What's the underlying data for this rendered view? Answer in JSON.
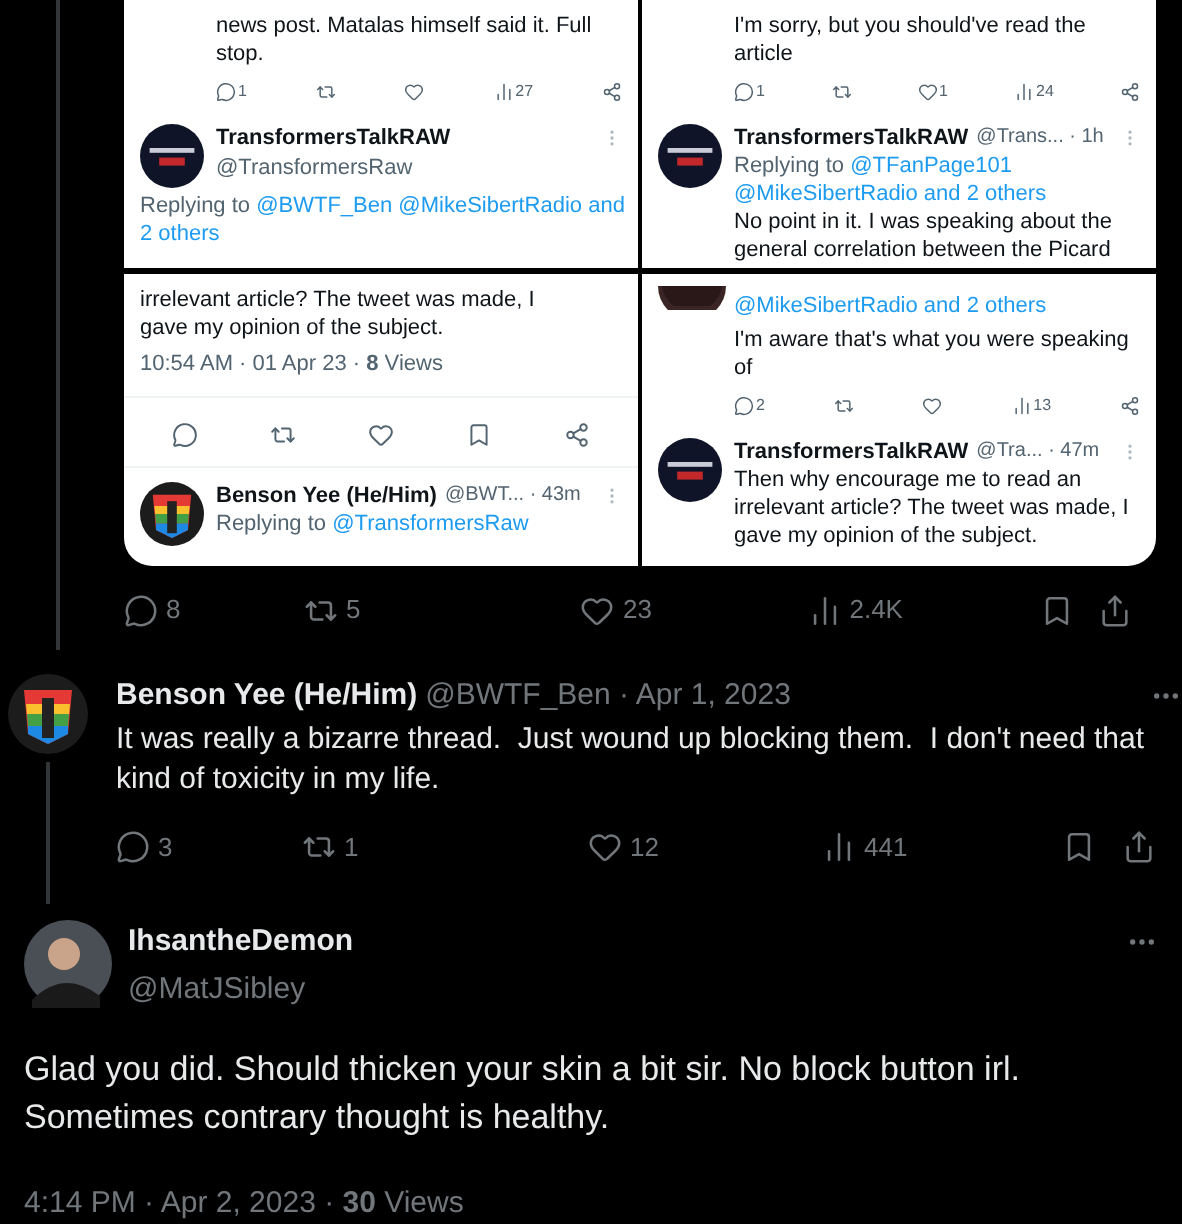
{
  "attached_image": {
    "columns": [
      {
        "panels": [
          {
            "kind": "thread",
            "blocks": [
              {
                "kind": "text",
                "lines": [
                  "news post.  Matalas himself said it.  Full",
                  "stop."
                ]
              },
              {
                "kind": "stats",
                "items": [
                  {
                    "kind": "reply",
                    "count": "1"
                  },
                  {
                    "kind": "repost"
                  },
                  {
                    "kind": "like"
                  },
                  {
                    "kind": "views",
                    "count": "27"
                  },
                  {
                    "kind": "share"
                  }
                ]
              },
              {
                "kind": "post",
                "avatar": {
                  "kind": "logo"
                },
                "name": "TransformersTalkRAW",
                "handle_line": "@TransformersRaw",
                "replying": {
                  "prefix": "Replying to",
                  "links": [
                    "@BWTF_Ben @MikeSibertRadio and",
                    "2 others"
                  ]
                }
              }
            ]
          },
          {
            "kind": "focused",
            "blocks": [
              {
                "kind": "text",
                "lines": [
                  "irrelevant article? The tweet was made, I",
                  "gave my opinion of the subject."
                ]
              },
              {
                "kind": "meta",
                "text": "10:54 AM · 01 Apr 23 · **8** Views"
              },
              {
                "kind": "stats",
                "items": [
                  {
                    "kind": "reply"
                  },
                  {
                    "kind": "repost"
                  },
                  {
                    "kind": "like"
                  },
                  {
                    "kind": "bookmark"
                  },
                  {
                    "kind": "share"
                  }
                ]
              },
              {
                "kind": "post",
                "avatar": {
                  "kind": "rainbow"
                },
                "name": "Benson Yee (He/Him)",
                "meta": "@BWT... · 43m",
                "replying": {
                  "prefix": "Replying to",
                  "links": [
                    "@TransformersRaw"
                  ]
                }
              }
            ]
          }
        ]
      },
      {
        "panels": [
          {
            "kind": "thread",
            "blocks": [
              {
                "kind": "text",
                "lines": [
                  "I'm sorry, but you should've read the",
                  "article"
                ]
              },
              {
                "kind": "stats",
                "items": [
                  {
                    "kind": "reply",
                    "count": "1"
                  },
                  {
                    "kind": "repost"
                  },
                  {
                    "kind": "like",
                    "count": "1"
                  },
                  {
                    "kind": "views",
                    "count": "24"
                  },
                  {
                    "kind": "share"
                  }
                ]
              },
              {
                "kind": "post",
                "avatar": {
                  "kind": "logo"
                },
                "name": "TransformersTalkRAW",
                "meta": "@Trans... · 1h",
                "replying": {
                  "prefix": "Replying to",
                  "links": [
                    "@TFanPage101",
                    "@MikeSibertRadio and 2 others"
                  ]
                },
                "body": [
                  "No point in it. I was speaking about the",
                  "general correlation between the Picard"
                ]
              }
            ]
          },
          {
            "kind": "thread",
            "blocks": [
              {
                "kind": "avatar_stub"
              },
              {
                "kind": "links",
                "links": [
                  "@MikeSibertRadio and 2 others"
                ]
              },
              {
                "kind": "text",
                "lines": [
                  "I'm aware that's what you were speaking",
                  "of"
                ]
              },
              {
                "kind": "stats",
                "items": [
                  {
                    "kind": "reply",
                    "count": "2"
                  },
                  {
                    "kind": "repost"
                  },
                  {
                    "kind": "like"
                  },
                  {
                    "kind": "views",
                    "count": "13"
                  },
                  {
                    "kind": "share"
                  }
                ]
              },
              {
                "kind": "post",
                "avatar": {
                  "kind": "logo"
                },
                "name": "TransformersTalkRAW",
                "meta": "@Tra... · 47m",
                "body": [
                  "Then why encourage me to read an",
                  "irrelevant article? The tweet was made, I",
                  "gave my opinion of the subject."
                ]
              }
            ]
          }
        ]
      }
    ]
  },
  "tweet_actions": [
    {
      "kind": "reply",
      "count": "8"
    },
    {
      "kind": "repost",
      "count": "5"
    },
    {
      "kind": "like",
      "count": "23"
    },
    {
      "kind": "views",
      "count": "2.4K"
    },
    {
      "kind": "bookmark"
    },
    {
      "kind": "upload"
    }
  ],
  "reply": {
    "avatar": {
      "kind": "rainbow"
    },
    "name": "Benson Yee (He/Him)",
    "meta": "@BWTF_Ben · Apr 1, 2023",
    "text": "It was really a bizarre thread.  Just wound up blocking them.  I don't need that kind of toxicity in my life.",
    "actions": [
      {
        "kind": "reply",
        "count": "3"
      },
      {
        "kind": "repost",
        "count": "1"
      },
      {
        "kind": "like",
        "count": "12"
      },
      {
        "kind": "views",
        "count": "441"
      },
      {
        "kind": "bookmark"
      },
      {
        "kind": "upload"
      }
    ]
  },
  "focused_tweet": {
    "avatar": {
      "kind": "person"
    },
    "name": "IhsantheDemon",
    "handle": "@MatJSibley",
    "text": "Glad you did. Should thicken your skin a bit sir. No block button irl. Sometimes contrary thought is healthy.",
    "meta": "4:14 PM · Apr 2, 2023 · **30** Views"
  }
}
